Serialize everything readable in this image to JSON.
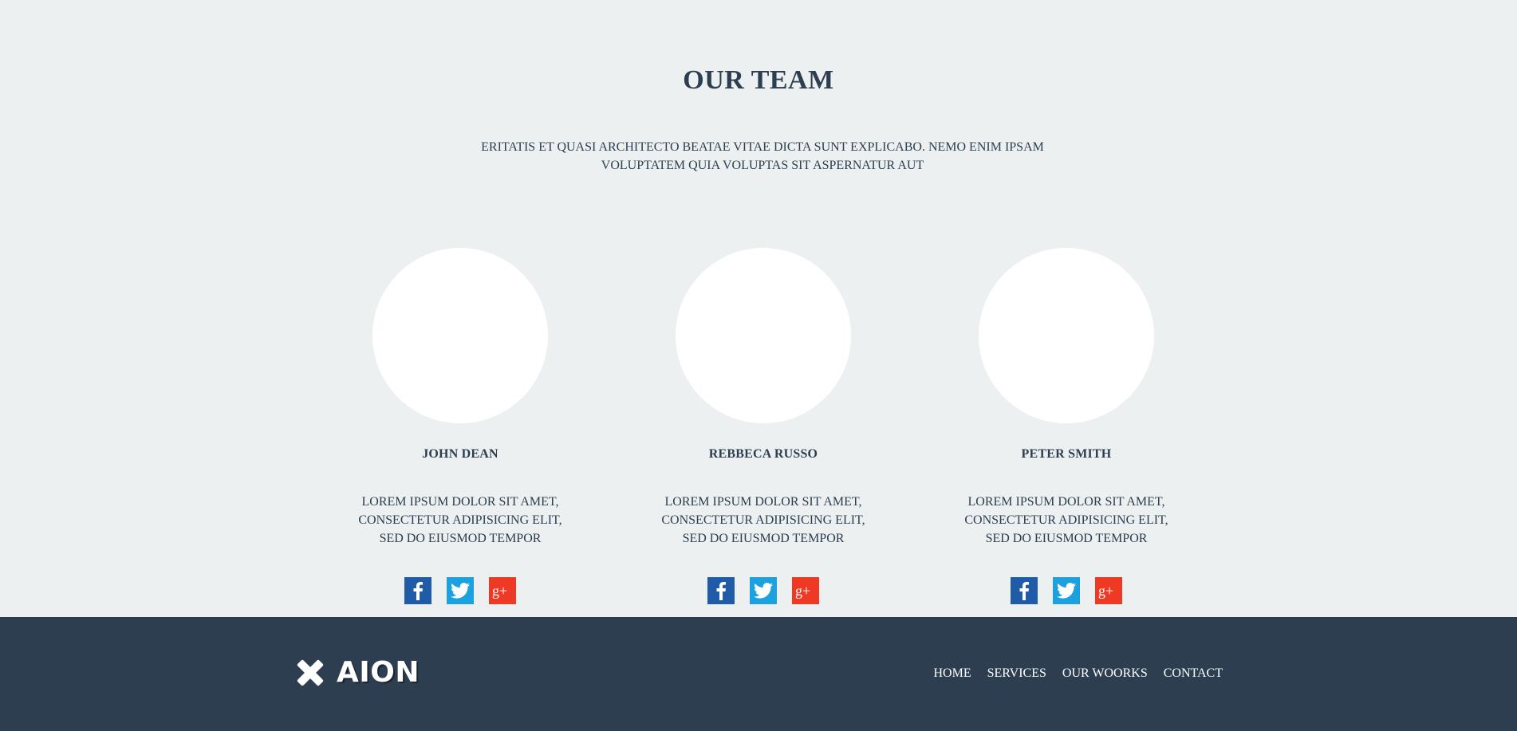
{
  "team": {
    "title": "OUR TEAM",
    "intro_line1": "ERITATIS ET QUASI ARCHITECTO BEATAE VITAE DICTA SUNT EXPLICABO. NEMO ENIM IPSAM",
    "intro_line2": "VOLUPTATEM QUIA VOLUPTAS SIT ASPERNATUR AUT",
    "members": [
      {
        "name": "JOHN DEAN",
        "bio_line1": "LOREM IPSUM DOLOR SIT AMET,",
        "bio_line2": "CONSECTETUR ADIPISICING ELIT,",
        "bio_line3": "SED DO EIUSMOD TEMPOR"
      },
      {
        "name": "REBBECA RUSSO",
        "bio_line1": "LOREM IPSUM DOLOR SIT AMET,",
        "bio_line2": "CONSECTETUR ADIPISICING ELIT,",
        "bio_line3": "SED DO EIUSMOD TEMPOR"
      },
      {
        "name": "PETER SMITH",
        "bio_line1": "LOREM IPSUM DOLOR SIT AMET,",
        "bio_line2": "CONSECTETUR ADIPISICING ELIT,",
        "bio_line3": "SED DO EIUSMOD TEMPOR"
      }
    ],
    "social_icons": [
      "facebook-icon",
      "twitter-icon",
      "google-plus-icon"
    ]
  },
  "footer": {
    "logo_text": "AION",
    "nav": [
      "HOME",
      "SERVICES",
      "OUR WOORKS",
      "CONTACT"
    ]
  },
  "colors": {
    "background": "#ecf0f1",
    "text": "#2c3e50",
    "footer_bg": "#2c3e50",
    "facebook": "#1f5ba6",
    "twitter": "#1ca0de",
    "google_plus": "#ee3a24"
  }
}
